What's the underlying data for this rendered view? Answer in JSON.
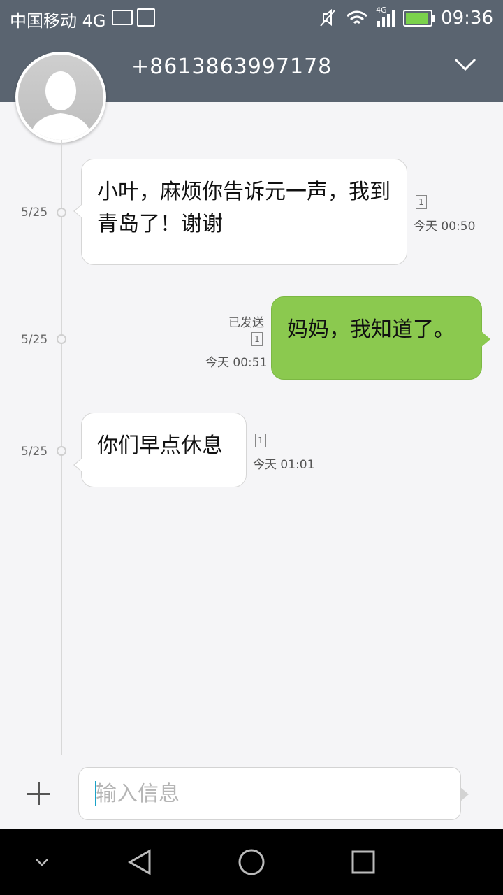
{
  "status_bar": {
    "carrier": "中国移动 4G",
    "network_label": "4G",
    "time": "09:36",
    "battery_color": "#7bd24c"
  },
  "header": {
    "contact_number": "+8613863997178",
    "expand_icon": "chevron-down-icon",
    "background": "#5a6470"
  },
  "messages": [
    {
      "direction": "incoming",
      "date": "5/25",
      "text": "小叶，麻烦你告诉元一声，我到青岛了！谢谢",
      "sim": "1",
      "time": "今天 00:50"
    },
    {
      "direction": "outgoing",
      "date": "5/25",
      "text": "妈妈，我知道了。",
      "status": "已发送",
      "sim": "1",
      "time": "今天 00:51",
      "bubble_color": "#8bc94f"
    },
    {
      "direction": "incoming",
      "date": "5/25",
      "text": "你们早点休息",
      "sim": "1",
      "time": "今天 01:01"
    }
  ],
  "composer": {
    "placeholder": "输入信息",
    "value": ""
  },
  "nav": {
    "items": [
      "collapse-icon",
      "back-icon",
      "home-icon",
      "recents-icon"
    ]
  }
}
